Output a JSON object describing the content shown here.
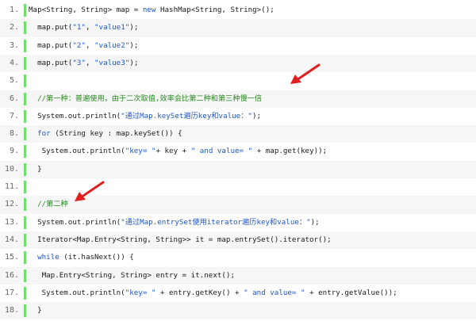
{
  "lines": [
    {
      "num": "1.",
      "parts": [
        {
          "t": "Map<String, String> map = "
        },
        {
          "t": "new",
          "c": "kw"
        },
        {
          "t": " HashMap<String, String>();"
        }
      ]
    },
    {
      "num": "2.",
      "parts": [
        {
          "t": "  map.put("
        },
        {
          "t": "\"1\"",
          "c": "str"
        },
        {
          "t": ", "
        },
        {
          "t": "\"value1\"",
          "c": "str"
        },
        {
          "t": ");"
        }
      ]
    },
    {
      "num": "3.",
      "parts": [
        {
          "t": "  map.put("
        },
        {
          "t": "\"2\"",
          "c": "str"
        },
        {
          "t": ", "
        },
        {
          "t": "\"value2\"",
          "c": "str"
        },
        {
          "t": ");"
        }
      ]
    },
    {
      "num": "4.",
      "parts": [
        {
          "t": "  map.put("
        },
        {
          "t": "\"3\"",
          "c": "str"
        },
        {
          "t": ", "
        },
        {
          "t": "\"value3\"",
          "c": "str"
        },
        {
          "t": ");"
        }
      ]
    },
    {
      "num": "5.",
      "parts": []
    },
    {
      "num": "6.",
      "parts": [
        {
          "t": "  //第一种：普遍使用，由于二次取值,效率会比第二种和第三种慢一倍",
          "c": "cm"
        }
      ]
    },
    {
      "num": "7.",
      "parts": [
        {
          "t": "  System.out.println("
        },
        {
          "t": "\"通过Map.keySet遍历key和value：\"",
          "c": "str"
        },
        {
          "t": ");"
        }
      ]
    },
    {
      "num": "8.",
      "parts": [
        {
          "t": "  "
        },
        {
          "t": "for",
          "c": "kw"
        },
        {
          "t": " (String key : map.keySet()) {"
        }
      ]
    },
    {
      "num": "9.",
      "parts": [
        {
          "t": "   System.out.println("
        },
        {
          "t": "\"key= \"",
          "c": "str"
        },
        {
          "t": "+ key + "
        },
        {
          "t": "\" and value= \"",
          "c": "str"
        },
        {
          "t": " + map.get(key));"
        }
      ]
    },
    {
      "num": "10.",
      "parts": [
        {
          "t": "  }"
        }
      ]
    },
    {
      "num": "11.",
      "parts": []
    },
    {
      "num": "12.",
      "parts": [
        {
          "t": "  //第二种",
          "c": "cm"
        }
      ]
    },
    {
      "num": "13.",
      "parts": [
        {
          "t": "  System.out.println("
        },
        {
          "t": "\"通过Map.entrySet使用iterator遍历key和value：\"",
          "c": "str"
        },
        {
          "t": ");"
        }
      ]
    },
    {
      "num": "14.",
      "parts": [
        {
          "t": "  Iterator<Map.Entry<String, String>> it = map.entrySet().iterator();"
        }
      ]
    },
    {
      "num": "15.",
      "parts": [
        {
          "t": "  "
        },
        {
          "t": "while",
          "c": "kw"
        },
        {
          "t": " (it.hasNext()) {"
        }
      ]
    },
    {
      "num": "16.",
      "parts": [
        {
          "t": "   Map.Entry<String, String> entry = it.next();"
        }
      ]
    },
    {
      "num": "17.",
      "parts": [
        {
          "t": "   System.out.println("
        },
        {
          "t": "\"key= \"",
          "c": "str"
        },
        {
          "t": " + entry.getKey() + "
        },
        {
          "t": "\" and value= \"",
          "c": "str"
        },
        {
          "t": " + entry.getValue());"
        }
      ]
    },
    {
      "num": "18.",
      "parts": [
        {
          "t": "  }"
        }
      ]
    }
  ],
  "colors": {
    "keyword": "#1f56c9",
    "string": "#1f56c9",
    "comment": "#2a8a23",
    "gutter_bar": "#6ce26c",
    "arrow": "#e02020"
  },
  "annotations": [
    "red-arrow",
    "red-arrow"
  ]
}
